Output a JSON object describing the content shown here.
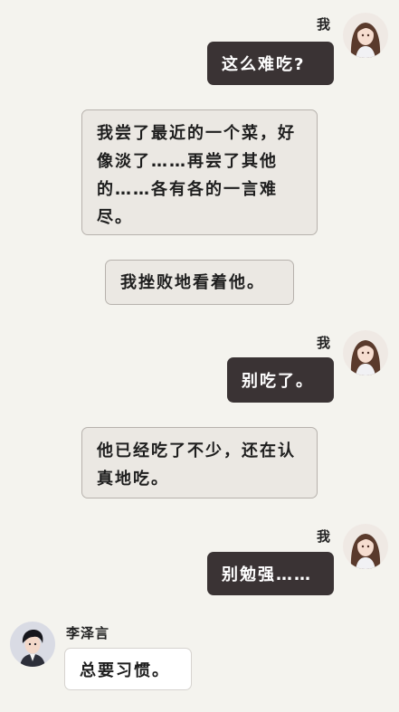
{
  "messages": [
    {
      "speaker": "我",
      "text": "这么难吃?"
    },
    {
      "text": "我尝了最近的一个菜，好像淡了……再尝了其他的……各有各的一言难尽。"
    },
    {
      "text": "我挫败地看着他。"
    },
    {
      "speaker": "我",
      "text": "别吃了。"
    },
    {
      "text": "他已经吃了不少，还在认真地吃。"
    },
    {
      "speaker": "我",
      "text": "别勉强……"
    },
    {
      "speaker": "李泽言",
      "text": "总要习惯。"
    }
  ],
  "icons": {
    "player_avatar": "female-avatar-icon",
    "partner_avatar": "male-avatar-icon"
  },
  "colors": {
    "background": "#f4f3ee",
    "player_bubble": "#3a3334",
    "narration_bubble": "#ebe8e3",
    "partner_bubble": "#ffffff"
  }
}
